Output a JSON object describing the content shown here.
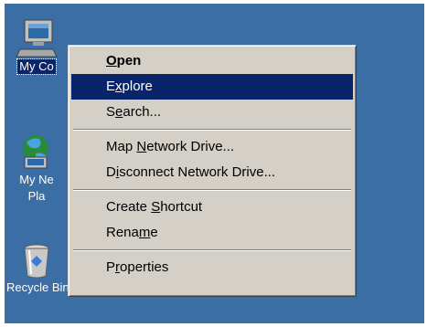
{
  "desktop": {
    "background_color": "#3a6ea5",
    "icons": [
      {
        "label": "My Computer",
        "visible_label": "My Co",
        "icon": "my-computer-icon"
      },
      {
        "label": "My Network Places",
        "visible_label_line1": "My Ne",
        "visible_label_line2": "Pla",
        "icon": "network-places-icon"
      },
      {
        "label": "Recycle Bin",
        "icon": "recycle-bin-icon"
      }
    ]
  },
  "context_menu": {
    "items": [
      {
        "label": "Open",
        "mnemonic_index": 0,
        "bold": true
      },
      {
        "label": "Explore",
        "mnemonic_index": 1,
        "highlighted": true
      },
      {
        "label": "Search...",
        "mnemonic_index": 1
      },
      {
        "separator": true
      },
      {
        "label": "Map Network Drive...",
        "mnemonic_index": 4
      },
      {
        "label": "Disconnect Network Drive...",
        "mnemonic_index": 1
      },
      {
        "separator": true
      },
      {
        "label": "Create Shortcut",
        "mnemonic_index": 7
      },
      {
        "label": "Rename",
        "mnemonic_index": 4
      },
      {
        "separator": true
      },
      {
        "label": "Properties",
        "mnemonic_index": 1
      }
    ],
    "highlight_color": "#0a246a",
    "face_color": "#d4d0c8"
  }
}
